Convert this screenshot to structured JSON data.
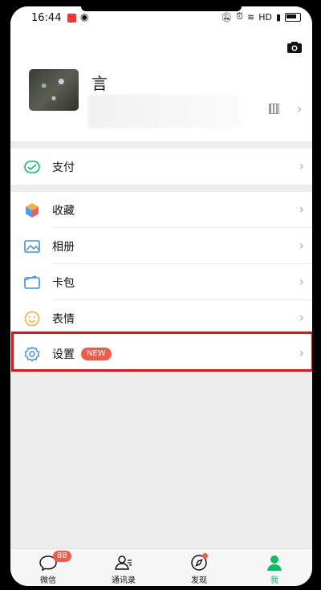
{
  "status": {
    "time": "16:44",
    "network": "HD"
  },
  "profile": {
    "name": "言"
  },
  "pay": {
    "label": "支付"
  },
  "menu": [
    {
      "label": "收藏"
    },
    {
      "label": "相册"
    },
    {
      "label": "卡包"
    },
    {
      "label": "表情"
    }
  ],
  "settings": {
    "label": "设置",
    "badge": "NEW"
  },
  "tabs": [
    {
      "label": "微信",
      "badge": "88"
    },
    {
      "label": "通讯录"
    },
    {
      "label": "发现"
    },
    {
      "label": "我"
    }
  ],
  "colors": {
    "accent": "#07c160",
    "badge": "#f25a4a",
    "highlight": "#e01414"
  }
}
